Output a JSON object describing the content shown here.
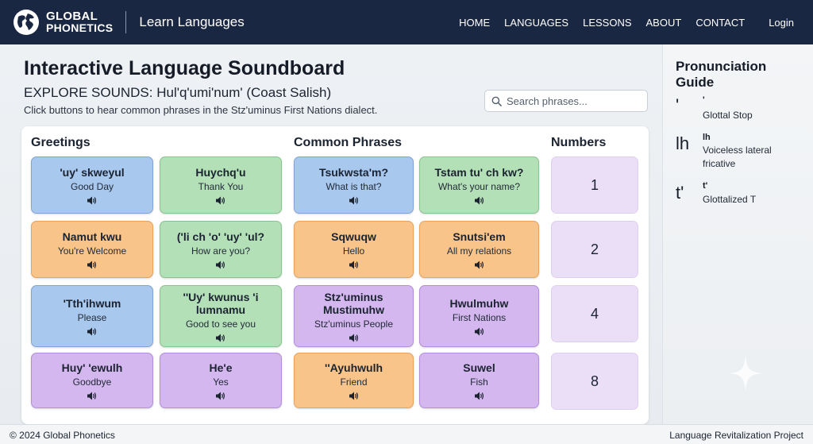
{
  "brand": {
    "line1": "GLOBAL",
    "line2": "PHONETICS",
    "site_title": "Learn Languages"
  },
  "nav": {
    "items": [
      "HOME",
      "LANGUAGES",
      "LESSONS",
      "ABOUT",
      "CONTACT"
    ],
    "login": "Login"
  },
  "page": {
    "title": "Interactive Language Soundboard",
    "subtitle": "EXPLORE SOUNDS: Hul'q'umi'num' (Coast Salish)",
    "description": "Click buttons to hear common phrases in the Stz'uminus First Nations dialect.",
    "search_placeholder": "Search phrases..."
  },
  "sections": {
    "greetings": "Greetings",
    "common": "Common Phrases",
    "numbers": "Numbers"
  },
  "cards": [
    {
      "phrase": "'uy' skweyul",
      "translation": "Good Day",
      "color": "blue"
    },
    {
      "phrase": "Huychq'u",
      "translation": "Thank You",
      "color": "green"
    },
    {
      "phrase": "Tsukwsta'm?",
      "translation": "What is that?",
      "color": "blue"
    },
    {
      "phrase": "Tstam tu' ch kw?",
      "translation": "What's your name?",
      "color": "green"
    },
    {
      "phrase": "Namut kwu",
      "translation": "You're Welcome",
      "color": "orange"
    },
    {
      "phrase": "('li ch 'o' 'uy' 'ul?",
      "translation": "How are you?",
      "color": "green"
    },
    {
      "phrase": "Sqwuqw",
      "translation": "Hello",
      "color": "orange"
    },
    {
      "phrase": "Snutsi'em",
      "translation": "All my relations",
      "color": "orange"
    },
    {
      "phrase": "'Tth'ihwum",
      "translation": "Please",
      "color": "blue"
    },
    {
      "phrase": "''Uy' kwunus 'i lumnamu",
      "translation": "Good to see you",
      "color": "green"
    },
    {
      "phrase": "Stz'uminus Mustimuhw",
      "translation": "Stz'uminus People",
      "color": "purple"
    },
    {
      "phrase": "Hwulmuhw",
      "translation": "First Nations",
      "color": "purple"
    },
    {
      "phrase": "Huy' 'ewulh",
      "translation": "Goodbye",
      "color": "purple"
    },
    {
      "phrase": "He'e",
      "translation": "Yes",
      "color": "purple"
    },
    {
      "phrase": "''Ayuhwulh",
      "translation": "Friend",
      "color": "orange"
    },
    {
      "phrase": "Suwel",
      "translation": "Fish",
      "color": "purple"
    }
  ],
  "numbers": [
    "1",
    "2",
    "4",
    "8"
  ],
  "guide": {
    "title_line1": "Pronunciation",
    "title_line2": "Guide",
    "items": [
      {
        "symbol": "'",
        "name": "'",
        "description": "Glottal Stop"
      },
      {
        "symbol": "lh",
        "name": "lh",
        "description": "Voiceless lateral fricative"
      },
      {
        "symbol": "t'",
        "name": "t'",
        "description": "Glottalized T"
      }
    ]
  },
  "footer": {
    "copyright": "© 2024 Global Phonetics",
    "project": "Language Revitalization Project"
  },
  "colors": {
    "header_bg": "#1a2742",
    "blue": "#a9c8ee",
    "green": "#b4e0b8",
    "orange": "#f8c48a",
    "purple": "#d3b7ee",
    "number_bg": "#ebdff8"
  },
  "icons": {
    "speaker": "speaker-icon",
    "search": "search-icon",
    "globe": "globe-logo"
  }
}
